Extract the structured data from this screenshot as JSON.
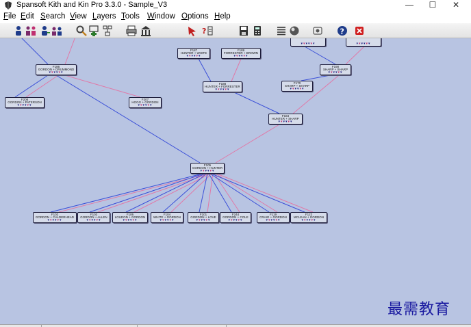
{
  "window": {
    "title": "Spansoft Kith and Kin Pro 3.3.0 - Sample_V3",
    "controls": [
      "—",
      "☐",
      "✕"
    ]
  },
  "menu": [
    {
      "label": "File",
      "mnemonic": "F"
    },
    {
      "label": "Edit",
      "mnemonic": "E"
    },
    {
      "label": "Search",
      "mnemonic": "S"
    },
    {
      "label": "View",
      "mnemonic": "V"
    },
    {
      "label": "Layers",
      "mnemonic": "L"
    },
    {
      "label": "Tools",
      "mnemonic": "T"
    },
    {
      "label": "Window",
      "mnemonic": "W"
    },
    {
      "label": "Options",
      "mnemonic": "O"
    },
    {
      "label": "Help",
      "mnemonic": "H"
    }
  ],
  "toolbar": [
    {
      "name": "add-person-icon",
      "color": "#1f3c8a"
    },
    {
      "name": "add-couple-icon",
      "color": "#7a2a6a"
    },
    {
      "name": "add-child-icon",
      "color": "#1f3c8a"
    },
    {
      "name": "add-sibling-icon",
      "color": "#7a2a6a"
    },
    {
      "name": "zoom-icon",
      "color": "#444444"
    },
    {
      "name": "add-family-icon",
      "color": "#2a7a2a"
    },
    {
      "name": "tree-icon",
      "color": "#333333"
    },
    {
      "name": "printer-icon",
      "color": "#333333"
    },
    {
      "name": "building-icon",
      "color": "#333333"
    },
    {
      "name": "pointer-icon",
      "color": "#c02020"
    },
    {
      "name": "help-pointer-icon",
      "color": "#c02020"
    },
    {
      "name": "save-icon",
      "color": "#333333"
    },
    {
      "name": "calculator-icon",
      "color": "#333333"
    },
    {
      "name": "list-icon",
      "color": "#333333"
    },
    {
      "name": "sphere-icon",
      "color": "#555555"
    },
    {
      "name": "settings-icon",
      "color": "#555555"
    },
    {
      "name": "help-icon",
      "color": "#1f3c8a"
    },
    {
      "name": "close-icon",
      "color": "#d02020"
    }
  ],
  "families": [
    {
      "id": "F186",
      "name": "GORDON + DRUMMOND"
    },
    {
      "id": "F208",
      "name": "GORDON + PATERSON"
    },
    {
      "id": "F207",
      "name": "HOGG + GORDON"
    },
    {
      "id": "F187",
      "name": "HUNTER + WHITE"
    },
    {
      "id": "F189",
      "name": "FORRESTER + BROWN"
    },
    {
      "id": "F188",
      "name": "HUNTER + FORRESTER"
    },
    {
      "id": "",
      "name": ""
    },
    {
      "id": "",
      "name": ""
    },
    {
      "id": "F190",
      "name": "SHARP + SHARP"
    },
    {
      "id": "F170",
      "name": "SHARP + SHARP"
    },
    {
      "id": "F184",
      "name": "HUNTER + SHARP"
    },
    {
      "id": "F105",
      "name": "GORDON + HUNTER"
    },
    {
      "id": "F102",
      "name": "GORDON + CALDERHEAD"
    },
    {
      "id": "F103",
      "name": "GORDON + ALLEN"
    },
    {
      "id": "F106",
      "name": "LOUDON + GORDON"
    },
    {
      "id": "F104",
      "name": "WHITE + GORDON"
    },
    {
      "id": "F101",
      "name": "GORDON + LOVE"
    },
    {
      "id": "F244",
      "name": "GORDON + COLE"
    },
    {
      "id": "F119",
      "name": "CRAIG + GORDON"
    },
    {
      "id": "F122",
      "name": "MCLEAN + GORDON"
    }
  ],
  "colors": {
    "canvas": "#b8c4e2",
    "male_line": "#3a4fd8",
    "female_line": "#e07aa8",
    "node_fill": "#d6dcea"
  },
  "watermark": "最需教育"
}
